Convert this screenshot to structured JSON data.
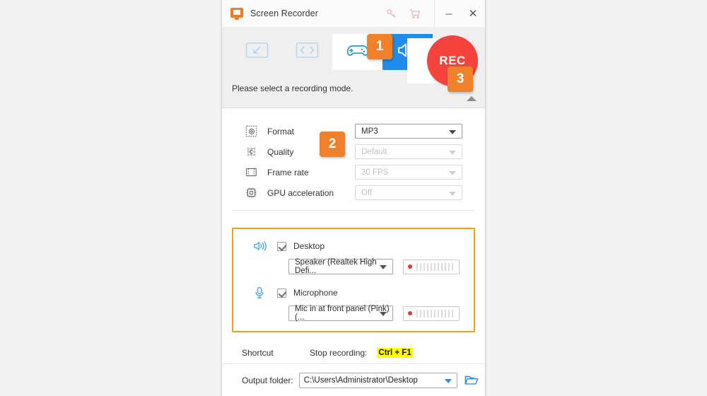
{
  "window": {
    "title": "Screen Recorder",
    "logo_icon": "screen-recorder-logo",
    "key_icon": "key-icon",
    "cart_icon": "cart-icon",
    "minimize_label": "─",
    "close_label": "✕"
  },
  "modes": {
    "items": [
      {
        "name": "custom-region",
        "icon": "region-arrow-icon",
        "state": "idle"
      },
      {
        "name": "fullscreen",
        "icon": "fullscreen-icon",
        "state": "idle"
      },
      {
        "name": "game",
        "icon": "gamepad-icon",
        "state": "selected"
      },
      {
        "name": "audio",
        "icon": "speaker-icon",
        "state": "active"
      }
    ],
    "record_label": "REC"
  },
  "status": {
    "message": "Please select a recording mode.",
    "collapse_icon": "chevron-up-icon"
  },
  "settings": {
    "rows": [
      {
        "icon": "format-icon",
        "label": "Format",
        "value": "MP3",
        "disabled": false
      },
      {
        "icon": "quality-icon",
        "label": "Quality",
        "value": "Default",
        "disabled": true
      },
      {
        "icon": "framerate-icon",
        "label": "Frame rate",
        "value": "30 FPS",
        "disabled": true
      },
      {
        "icon": "gpu-icon",
        "label": "GPU acceleration",
        "value": "Off",
        "disabled": true
      }
    ]
  },
  "audio": {
    "highlight_color": "#e8a317",
    "desktop": {
      "icon": "speaker-icon",
      "label": "Desktop",
      "checked": true,
      "device": "Speaker (Realtek High Defi...",
      "meter_bars": 11
    },
    "microphone": {
      "icon": "microphone-icon",
      "label": "Microphone",
      "checked": true,
      "device": "Mic in at front panel (Pink) (...",
      "meter_bars": 11
    }
  },
  "shortcut": {
    "label": "Shortcut",
    "action_label": "Stop recording:",
    "keys": "Ctrl + F1",
    "highlight_color": "#ffff00"
  },
  "output": {
    "label": "Output folder:",
    "path": "C:\\Users\\Administrator\\Desktop",
    "browse_icon": "folder-icon"
  },
  "badges": {
    "one": "1",
    "two": "2",
    "three": "3",
    "color": "#f0802a"
  }
}
